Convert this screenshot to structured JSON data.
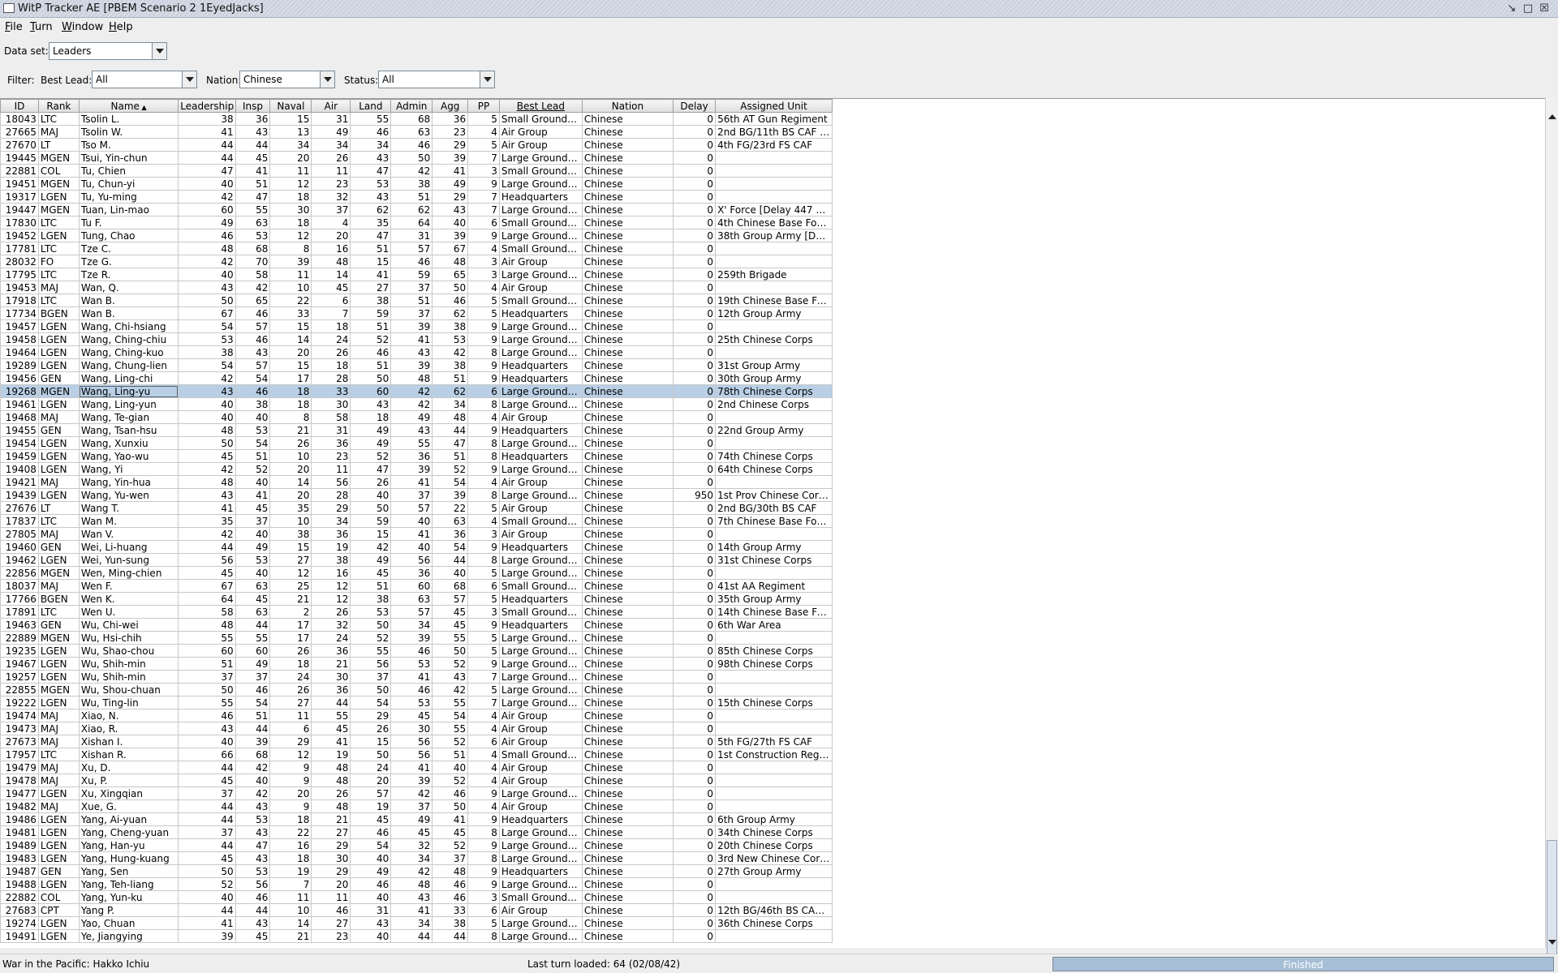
{
  "window": {
    "title": "WitP Tracker AE [PBEM Scenario 2 1EyedJacks]",
    "icon_name": "window-icon"
  },
  "menu": [
    {
      "mn": "F",
      "rest": "ile"
    },
    {
      "mn": "T",
      "rest": "urn"
    },
    {
      "mn": "W",
      "rest": "indow"
    },
    {
      "mn": "H",
      "rest": "elp"
    }
  ],
  "dataset": {
    "label": "Data set:",
    "value": "Leaders"
  },
  "filter": {
    "label": "Filter:",
    "best_lead_label": "Best Lead:",
    "best_lead_value": "All",
    "nation_label": "Nation:",
    "nation_value": "Chinese",
    "status_label": "Status:",
    "status_value": "All"
  },
  "table": {
    "columns": [
      "ID",
      "Rank",
      "Name",
      "Leadership",
      "Insp",
      "Naval",
      "Air",
      "Land",
      "Admin",
      "Agg",
      "PP",
      "Best Lead",
      "Nation",
      "Delay",
      "Assigned Unit"
    ],
    "sorted_column": "Name",
    "sort_direction": "ascending",
    "selected_id": "19268",
    "rows": [
      [
        "18043",
        "LTC",
        "Tsolin L.",
        "38",
        "36",
        "15",
        "31",
        "55",
        "68",
        "36",
        "5",
        "Small Ground U...",
        "Chinese",
        "0",
        "56th AT Gun Regiment"
      ],
      [
        "27665",
        "MAJ",
        "Tsolin W.",
        "41",
        "43",
        "13",
        "49",
        "46",
        "63",
        "23",
        "4",
        "Air Group",
        "Chinese",
        "0",
        "2nd BG/11th BS CAF [D..."
      ],
      [
        "27670",
        "LT",
        "Tso M.",
        "44",
        "44",
        "34",
        "34",
        "34",
        "46",
        "29",
        "5",
        "Air Group",
        "Chinese",
        "0",
        "4th FG/23rd FS CAF"
      ],
      [
        "19445",
        "MGEN",
        "Tsui, Yin-chun",
        "44",
        "45",
        "20",
        "26",
        "43",
        "50",
        "39",
        "7",
        "Large Ground U...",
        "Chinese",
        "0",
        ""
      ],
      [
        "22881",
        "COL",
        "Tu, Chien",
        "47",
        "41",
        "11",
        "11",
        "47",
        "42",
        "41",
        "3",
        "Small Ground U...",
        "Chinese",
        "0",
        ""
      ],
      [
        "19451",
        "MGEN",
        "Tu, Chun-yi",
        "40",
        "51",
        "12",
        "23",
        "53",
        "38",
        "49",
        "9",
        "Large Ground U...",
        "Chinese",
        "0",
        ""
      ],
      [
        "19317",
        "LGEN",
        "Tu, Yu-ming",
        "42",
        "47",
        "18",
        "32",
        "43",
        "51",
        "29",
        "7",
        "Headquarters",
        "Chinese",
        "0",
        ""
      ],
      [
        "19447",
        "MGEN",
        "Tuan, Lin-mao",
        "60",
        "55",
        "30",
        "37",
        "62",
        "62",
        "43",
        "7",
        "Large Ground U...",
        "Chinese",
        "0",
        "X' Force [Delay 447 days]"
      ],
      [
        "17830",
        "LTC",
        "Tu F.",
        "49",
        "63",
        "18",
        "4",
        "35",
        "64",
        "40",
        "6",
        "Small Ground U...",
        "Chinese",
        "0",
        "4th Chinese Base Force"
      ],
      [
        "19452",
        "LGEN",
        "Tung, Chao",
        "46",
        "53",
        "12",
        "20",
        "47",
        "31",
        "39",
        "9",
        "Large Ground U...",
        "Chinese",
        "0",
        "38th Group Army [Delay..."
      ],
      [
        "17781",
        "LTC",
        "Tze C.",
        "48",
        "68",
        "8",
        "16",
        "51",
        "57",
        "67",
        "4",
        "Small Ground U...",
        "Chinese",
        "0",
        ""
      ],
      [
        "28032",
        "FO",
        "Tze G.",
        "42",
        "70",
        "39",
        "48",
        "15",
        "46",
        "48",
        "3",
        "Air Group",
        "Chinese",
        "0",
        ""
      ],
      [
        "17795",
        "LTC",
        "Tze R.",
        "40",
        "58",
        "11",
        "14",
        "41",
        "59",
        "65",
        "3",
        "Large Ground U...",
        "Chinese",
        "0",
        "259th Brigade"
      ],
      [
        "19453",
        "MAJ",
        "Wan, Q.",
        "43",
        "42",
        "10",
        "45",
        "27",
        "37",
        "50",
        "4",
        "Air Group",
        "Chinese",
        "0",
        ""
      ],
      [
        "17918",
        "LTC",
        "Wan B.",
        "50",
        "65",
        "22",
        "6",
        "38",
        "51",
        "46",
        "5",
        "Small Ground U...",
        "Chinese",
        "0",
        "19th Chinese Base For..."
      ],
      [
        "17734",
        "BGEN",
        "Wan B.",
        "67",
        "46",
        "33",
        "7",
        "59",
        "37",
        "62",
        "5",
        "Headquarters",
        "Chinese",
        "0",
        "12th Group Army"
      ],
      [
        "19457",
        "LGEN",
        "Wang, Chi-hsiang",
        "54",
        "57",
        "15",
        "18",
        "51",
        "39",
        "38",
        "9",
        "Large Ground U...",
        "Chinese",
        "0",
        ""
      ],
      [
        "19458",
        "LGEN",
        "Wang, Ching-chiu",
        "53",
        "46",
        "14",
        "24",
        "52",
        "41",
        "53",
        "9",
        "Large Ground U...",
        "Chinese",
        "0",
        "25th Chinese Corps"
      ],
      [
        "19464",
        "LGEN",
        "Wang, Ching-kuo",
        "38",
        "43",
        "20",
        "26",
        "46",
        "43",
        "42",
        "8",
        "Large Ground U...",
        "Chinese",
        "0",
        ""
      ],
      [
        "19289",
        "LGEN",
        "Wang, Chung-lien",
        "54",
        "57",
        "15",
        "18",
        "51",
        "39",
        "38",
        "9",
        "Headquarters",
        "Chinese",
        "0",
        "31st Group Army"
      ],
      [
        "19456",
        "GEN",
        "Wang, Ling-chi",
        "42",
        "54",
        "17",
        "28",
        "50",
        "48",
        "51",
        "9",
        "Headquarters",
        "Chinese",
        "0",
        "30th Group Army"
      ],
      [
        "19268",
        "MGEN",
        "Wang, Ling-yu",
        "43",
        "46",
        "18",
        "33",
        "60",
        "42",
        "62",
        "6",
        "Large Ground U...",
        "Chinese",
        "0",
        "78th Chinese Corps"
      ],
      [
        "19461",
        "LGEN",
        "Wang, Ling-yun",
        "40",
        "38",
        "18",
        "30",
        "43",
        "42",
        "34",
        "8",
        "Large Ground U...",
        "Chinese",
        "0",
        "2nd Chinese Corps"
      ],
      [
        "19468",
        "MAJ",
        "Wang, Te-gian",
        "40",
        "40",
        "8",
        "58",
        "18",
        "49",
        "48",
        "4",
        "Air Group",
        "Chinese",
        "0",
        ""
      ],
      [
        "19455",
        "GEN",
        "Wang, Tsan-hsu",
        "48",
        "53",
        "21",
        "31",
        "49",
        "43",
        "44",
        "9",
        "Headquarters",
        "Chinese",
        "0",
        "22nd Group Army"
      ],
      [
        "19454",
        "LGEN",
        "Wang, Xunxiu",
        "50",
        "54",
        "26",
        "36",
        "49",
        "55",
        "47",
        "8",
        "Large Ground U...",
        "Chinese",
        "0",
        ""
      ],
      [
        "19459",
        "LGEN",
        "Wang, Yao-wu",
        "45",
        "51",
        "10",
        "23",
        "52",
        "36",
        "51",
        "8",
        "Headquarters",
        "Chinese",
        "0",
        "74th Chinese Corps"
      ],
      [
        "19408",
        "LGEN",
        "Wang, Yi",
        "42",
        "52",
        "20",
        "11",
        "47",
        "39",
        "52",
        "9",
        "Large Ground U...",
        "Chinese",
        "0",
        "64th Chinese Corps"
      ],
      [
        "19421",
        "MAJ",
        "Wang, Yin-hua",
        "48",
        "40",
        "14",
        "56",
        "26",
        "41",
        "54",
        "4",
        "Air Group",
        "Chinese",
        "0",
        ""
      ],
      [
        "19439",
        "LGEN",
        "Wang, Yu-wen",
        "43",
        "41",
        "20",
        "28",
        "40",
        "37",
        "39",
        "8",
        "Large Ground U...",
        "Chinese",
        "950",
        "1st Prov Chinese Corp..."
      ],
      [
        "27676",
        "LT",
        "Wang T.",
        "41",
        "45",
        "35",
        "29",
        "50",
        "57",
        "22",
        "5",
        "Air Group",
        "Chinese",
        "0",
        "2nd BG/30th BS CAF"
      ],
      [
        "17837",
        "LTC",
        "Wan M.",
        "35",
        "37",
        "10",
        "34",
        "59",
        "40",
        "63",
        "4",
        "Small Ground U...",
        "Chinese",
        "0",
        "7th Chinese Base Force"
      ],
      [
        "27805",
        "MAJ",
        "Wan V.",
        "42",
        "40",
        "38",
        "36",
        "15",
        "41",
        "36",
        "3",
        "Air Group",
        "Chinese",
        "0",
        ""
      ],
      [
        "19460",
        "GEN",
        "Wei, Li-huang",
        "44",
        "49",
        "15",
        "19",
        "42",
        "40",
        "54",
        "9",
        "Headquarters",
        "Chinese",
        "0",
        "14th Group Army"
      ],
      [
        "19462",
        "LGEN",
        "Wei, Yun-sung",
        "56",
        "53",
        "27",
        "38",
        "49",
        "56",
        "44",
        "8",
        "Large Ground U...",
        "Chinese",
        "0",
        "31st Chinese Corps"
      ],
      [
        "22856",
        "MGEN",
        "Wen, Ming-chien",
        "45",
        "40",
        "12",
        "16",
        "45",
        "36",
        "40",
        "5",
        "Large Ground U...",
        "Chinese",
        "0",
        ""
      ],
      [
        "18037",
        "MAJ",
        "Wen F.",
        "67",
        "63",
        "25",
        "12",
        "51",
        "60",
        "68",
        "6",
        "Small Ground U...",
        "Chinese",
        "0",
        "41st AA Regiment"
      ],
      [
        "17766",
        "BGEN",
        "Wen K.",
        "64",
        "45",
        "21",
        "12",
        "38",
        "63",
        "57",
        "5",
        "Headquarters",
        "Chinese",
        "0",
        "35th Group Army"
      ],
      [
        "17891",
        "LTC",
        "Wen U.",
        "58",
        "63",
        "2",
        "26",
        "53",
        "57",
        "45",
        "3",
        "Small Ground U...",
        "Chinese",
        "0",
        "14th Chinese Base For..."
      ],
      [
        "19463",
        "GEN",
        "Wu, Chi-wei",
        "48",
        "44",
        "17",
        "32",
        "50",
        "34",
        "45",
        "9",
        "Headquarters",
        "Chinese",
        "0",
        "6th War Area"
      ],
      [
        "22889",
        "MGEN",
        "Wu, Hsi-chih",
        "55",
        "55",
        "17",
        "24",
        "52",
        "39",
        "55",
        "5",
        "Large Ground U...",
        "Chinese",
        "0",
        ""
      ],
      [
        "19235",
        "LGEN",
        "Wu, Shao-chou",
        "60",
        "60",
        "26",
        "36",
        "55",
        "46",
        "50",
        "5",
        "Large Ground U...",
        "Chinese",
        "0",
        "85th Chinese Corps"
      ],
      [
        "19467",
        "LGEN",
        "Wu, Shih-min",
        "51",
        "49",
        "18",
        "21",
        "56",
        "53",
        "52",
        "9",
        "Large Ground U...",
        "Chinese",
        "0",
        "98th Chinese Corps"
      ],
      [
        "19257",
        "LGEN",
        "Wu, Shih-min",
        "37",
        "37",
        "24",
        "30",
        "37",
        "41",
        "43",
        "7",
        "Large Ground U...",
        "Chinese",
        "0",
        ""
      ],
      [
        "22855",
        "MGEN",
        "Wu, Shou-chuan",
        "50",
        "46",
        "26",
        "36",
        "50",
        "46",
        "42",
        "5",
        "Large Ground U...",
        "Chinese",
        "0",
        ""
      ],
      [
        "19222",
        "LGEN",
        "Wu, Ting-lin",
        "55",
        "54",
        "27",
        "44",
        "54",
        "53",
        "55",
        "7",
        "Large Ground U...",
        "Chinese",
        "0",
        "15th Chinese Corps"
      ],
      [
        "19474",
        "MAJ",
        "Xiao, N.",
        "46",
        "51",
        "11",
        "55",
        "29",
        "45",
        "54",
        "4",
        "Air Group",
        "Chinese",
        "0",
        ""
      ],
      [
        "19473",
        "MAJ",
        "Xiao, R.",
        "43",
        "44",
        "6",
        "45",
        "26",
        "30",
        "55",
        "4",
        "Air Group",
        "Chinese",
        "0",
        ""
      ],
      [
        "27673",
        "MAJ",
        "Xishan I.",
        "40",
        "39",
        "29",
        "41",
        "15",
        "56",
        "52",
        "6",
        "Air Group",
        "Chinese",
        "0",
        "5th FG/27th FS CAF"
      ],
      [
        "17957",
        "LTC",
        "Xishan R.",
        "66",
        "68",
        "12",
        "19",
        "50",
        "56",
        "51",
        "4",
        "Small Ground U...",
        "Chinese",
        "0",
        "1st Construction Regi..."
      ],
      [
        "19479",
        "MAJ",
        "Xu, D.",
        "44",
        "42",
        "9",
        "48",
        "24",
        "41",
        "40",
        "4",
        "Air Group",
        "Chinese",
        "0",
        ""
      ],
      [
        "19478",
        "MAJ",
        "Xu, P.",
        "45",
        "40",
        "9",
        "48",
        "20",
        "39",
        "52",
        "4",
        "Air Group",
        "Chinese",
        "0",
        ""
      ],
      [
        "19477",
        "LGEN",
        "Xu, Xingqian",
        "37",
        "42",
        "20",
        "26",
        "57",
        "42",
        "46",
        "9",
        "Large Ground U...",
        "Chinese",
        "0",
        ""
      ],
      [
        "19482",
        "MAJ",
        "Xue, G.",
        "44",
        "43",
        "9",
        "48",
        "19",
        "37",
        "50",
        "4",
        "Air Group",
        "Chinese",
        "0",
        ""
      ],
      [
        "19486",
        "LGEN",
        "Yang, Ai-yuan",
        "44",
        "53",
        "18",
        "21",
        "45",
        "49",
        "41",
        "9",
        "Headquarters",
        "Chinese",
        "0",
        "6th Group Army"
      ],
      [
        "19481",
        "LGEN",
        "Yang, Cheng-yuan",
        "37",
        "43",
        "22",
        "27",
        "46",
        "45",
        "45",
        "8",
        "Large Ground U...",
        "Chinese",
        "0",
        "34th Chinese Corps"
      ],
      [
        "19489",
        "LGEN",
        "Yang, Han-yu",
        "44",
        "47",
        "16",
        "29",
        "54",
        "32",
        "52",
        "9",
        "Large Ground U...",
        "Chinese",
        "0",
        "20th Chinese Corps"
      ],
      [
        "19483",
        "LGEN",
        "Yang, Hung-kuang",
        "45",
        "43",
        "18",
        "30",
        "40",
        "34",
        "37",
        "8",
        "Large Ground U...",
        "Chinese",
        "0",
        "3rd New Chinese Corps"
      ],
      [
        "19487",
        "GEN",
        "Yang, Sen",
        "50",
        "53",
        "19",
        "29",
        "49",
        "42",
        "48",
        "9",
        "Headquarters",
        "Chinese",
        "0",
        "27th Group Army"
      ],
      [
        "19488",
        "LGEN",
        "Yang, Teh-liang",
        "52",
        "56",
        "7",
        "20",
        "46",
        "48",
        "46",
        "9",
        "Large Ground U...",
        "Chinese",
        "0",
        ""
      ],
      [
        "22882",
        "COL",
        "Yang, Yun-ku",
        "40",
        "46",
        "11",
        "11",
        "40",
        "43",
        "46",
        "3",
        "Small Ground U...",
        "Chinese",
        "0",
        ""
      ],
      [
        "27683",
        "CPT",
        "Yang P.",
        "44",
        "44",
        "10",
        "46",
        "31",
        "41",
        "33",
        "6",
        "Air Group",
        "Chinese",
        "0",
        "12th BG/46th BS CAF [..."
      ],
      [
        "19274",
        "LGEN",
        "Yao, Chuan",
        "41",
        "43",
        "14",
        "27",
        "43",
        "34",
        "38",
        "5",
        "Large Ground U...",
        "Chinese",
        "0",
        "36th Chinese Corps"
      ],
      [
        "19491",
        "LGEN",
        "Ye, Jiangying",
        "39",
        "45",
        "21",
        "23",
        "40",
        "44",
        "44",
        "8",
        "Large Ground U...",
        "Chinese",
        "0",
        ""
      ]
    ]
  },
  "status": {
    "left": "War in the Pacific: Hakko Ichiu",
    "middle": "Last turn loaded: 64 (02/08/42)",
    "progress_label": "Finished",
    "progress_fraction": 1.0
  }
}
